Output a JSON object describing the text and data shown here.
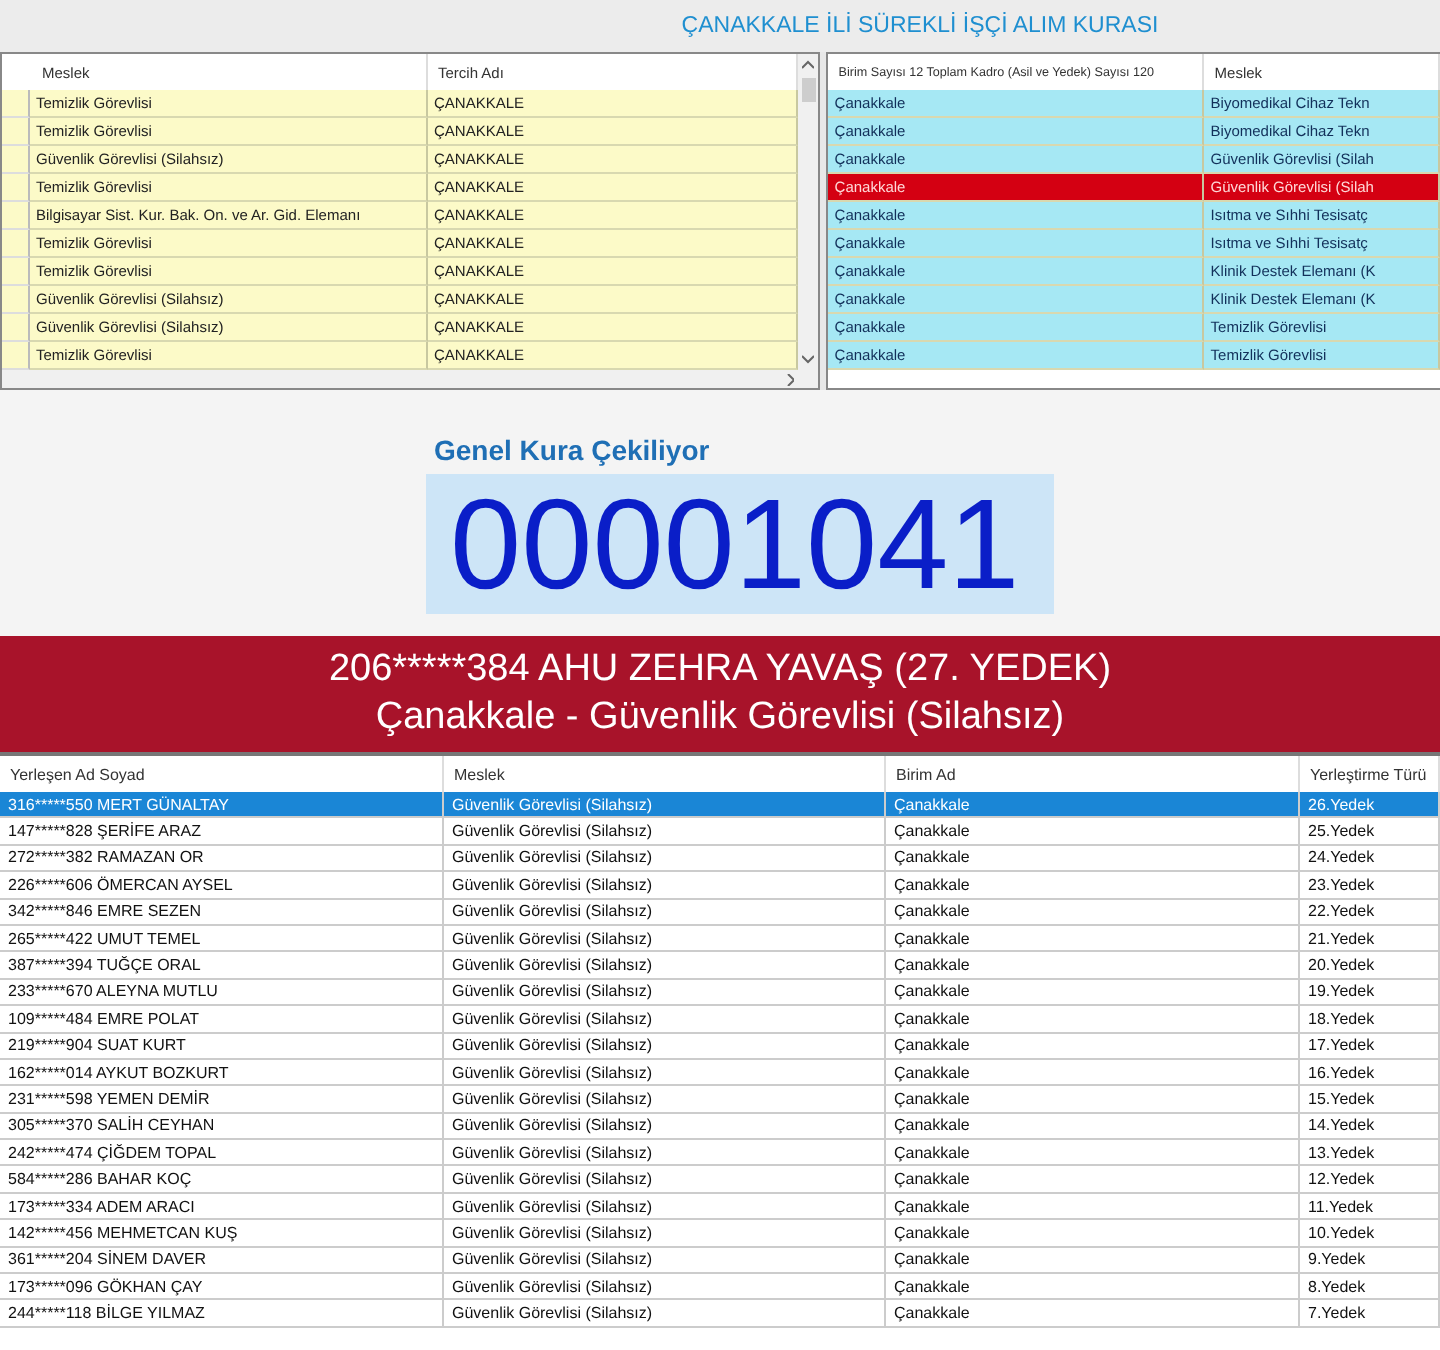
{
  "title": "ÇANAKKALE İLİ SÜREKLİ İŞÇİ ALIM KURASI",
  "preference_table": {
    "columns": [
      "Meslek",
      "Tercih Adı"
    ],
    "rows": [
      {
        "cells": [
          "Temizlik Görevlisi",
          "ÇANAKKALE"
        ]
      },
      {
        "cells": [
          "Temizlik Görevlisi",
          "ÇANAKKALE"
        ]
      },
      {
        "cells": [
          "Güvenlik Görevlisi (Silahsız)",
          "ÇANAKKALE"
        ]
      },
      {
        "cells": [
          "Temizlik Görevlisi",
          "ÇANAKKALE"
        ]
      },
      {
        "cells": [
          "Bilgisayar Sist. Kur. Bak. On. ve Ar. Gid. Elemanı",
          "ÇANAKKALE"
        ]
      },
      {
        "cells": [
          "Temizlik Görevlisi",
          "ÇANAKKALE"
        ]
      },
      {
        "cells": [
          "Temizlik Görevlisi",
          "ÇANAKKALE"
        ]
      },
      {
        "cells": [
          "Güvenlik Görevlisi (Silahsız)",
          "ÇANAKKALE"
        ]
      },
      {
        "cells": [
          "Güvenlik Görevlisi (Silahsız)",
          "ÇANAKKALE"
        ]
      },
      {
        "cells": [
          "Temizlik Görevlisi",
          "ÇANAKKALE"
        ]
      }
    ]
  },
  "unit_table": {
    "columns": [
      "Birim Sayısı 12 Toplam Kadro (Asil ve Yedek) Sayısı 120",
      "Meslek"
    ],
    "rows": [
      {
        "cells": [
          "Çanakkale",
          "Biyomedikal Cihaz Tekn"
        ],
        "selected": false
      },
      {
        "cells": [
          "Çanakkale",
          "Biyomedikal Cihaz Tekn"
        ],
        "selected": false
      },
      {
        "cells": [
          "Çanakkale",
          "Güvenlik Görevlisi (Silah"
        ],
        "selected": false
      },
      {
        "cells": [
          "Çanakkale",
          "Güvenlik Görevlisi (Silah"
        ],
        "selected": true
      },
      {
        "cells": [
          "Çanakkale",
          "Isıtma ve Sıhhi Tesisatç"
        ],
        "selected": false
      },
      {
        "cells": [
          "Çanakkale",
          "Isıtma ve Sıhhi Tesisatç"
        ],
        "selected": false
      },
      {
        "cells": [
          "Çanakkale",
          "Klinik Destek Elemanı (K"
        ],
        "selected": false
      },
      {
        "cells": [
          "Çanakkale",
          "Klinik Destek Elemanı (K"
        ],
        "selected": false
      },
      {
        "cells": [
          "Çanakkale",
          "Temizlik Görevlisi"
        ],
        "selected": false
      },
      {
        "cells": [
          "Çanakkale",
          "Temizlik Görevlisi"
        ],
        "selected": false
      }
    ]
  },
  "draw": {
    "label": "Genel Kura Çekiliyor",
    "number": "00001041",
    "result_line_1": "206*****384 AHU ZEHRA YAVAŞ (27. YEDEK)",
    "result_line_2": "Çanakkale - Güvenlik Görevlisi (Silahsız)"
  },
  "placement_table": {
    "columns": [
      "Yerleşen Ad Soyad",
      "Meslek",
      "Birim Ad",
      "Yerleştirme Türü"
    ],
    "rows": [
      {
        "cells": [
          "316*****550 MERT GÜNALTAY",
          "Güvenlik Görevlisi (Silahsız)",
          "Çanakkale",
          "26.Yedek"
        ],
        "selected": true
      },
      {
        "cells": [
          "147*****828 ŞERİFE ARAZ",
          "Güvenlik Görevlisi (Silahsız)",
          "Çanakkale",
          "25.Yedek"
        ],
        "selected": false
      },
      {
        "cells": [
          "272*****382 RAMAZAN OR",
          "Güvenlik Görevlisi (Silahsız)",
          "Çanakkale",
          "24.Yedek"
        ],
        "selected": false
      },
      {
        "cells": [
          "226*****606 ÖMERCAN AYSEL",
          "Güvenlik Görevlisi (Silahsız)",
          "Çanakkale",
          "23.Yedek"
        ],
        "selected": false
      },
      {
        "cells": [
          "342*****846 EMRE SEZEN",
          "Güvenlik Görevlisi (Silahsız)",
          "Çanakkale",
          "22.Yedek"
        ],
        "selected": false
      },
      {
        "cells": [
          "265*****422 UMUT TEMEL",
          "Güvenlik Görevlisi (Silahsız)",
          "Çanakkale",
          "21.Yedek"
        ],
        "selected": false
      },
      {
        "cells": [
          "387*****394 TUĞÇE ORAL",
          "Güvenlik Görevlisi (Silahsız)",
          "Çanakkale",
          "20.Yedek"
        ],
        "selected": false
      },
      {
        "cells": [
          "233*****670 ALEYNA MUTLU",
          "Güvenlik Görevlisi (Silahsız)",
          "Çanakkale",
          "19.Yedek"
        ],
        "selected": false
      },
      {
        "cells": [
          "109*****484 EMRE POLAT",
          "Güvenlik Görevlisi (Silahsız)",
          "Çanakkale",
          "18.Yedek"
        ],
        "selected": false
      },
      {
        "cells": [
          "219*****904 SUAT KURT",
          "Güvenlik Görevlisi (Silahsız)",
          "Çanakkale",
          "17.Yedek"
        ],
        "selected": false
      },
      {
        "cells": [
          "162*****014 AYKUT BOZKURT",
          "Güvenlik Görevlisi (Silahsız)",
          "Çanakkale",
          "16.Yedek"
        ],
        "selected": false
      },
      {
        "cells": [
          "231*****598 YEMEN DEMİR",
          "Güvenlik Görevlisi (Silahsız)",
          "Çanakkale",
          "15.Yedek"
        ],
        "selected": false
      },
      {
        "cells": [
          "305*****370 SALİH CEYHAN",
          "Güvenlik Görevlisi (Silahsız)",
          "Çanakkale",
          "14.Yedek"
        ],
        "selected": false
      },
      {
        "cells": [
          "242*****474 ÇİĞDEM TOPAL",
          "Güvenlik Görevlisi (Silahsız)",
          "Çanakkale",
          "13.Yedek"
        ],
        "selected": false
      },
      {
        "cells": [
          "584*****286 BAHAR KOÇ",
          "Güvenlik Görevlisi (Silahsız)",
          "Çanakkale",
          "12.Yedek"
        ],
        "selected": false
      },
      {
        "cells": [
          "173*****334 ADEM ARACI",
          "Güvenlik Görevlisi (Silahsız)",
          "Çanakkale",
          "11.Yedek"
        ],
        "selected": false
      },
      {
        "cells": [
          "142*****456 MEHMETCAN KUŞ",
          "Güvenlik Görevlisi (Silahsız)",
          "Çanakkale",
          "10.Yedek"
        ],
        "selected": false
      },
      {
        "cells": [
          "361*****204 SİNEM DAVER",
          "Güvenlik Görevlisi (Silahsız)",
          "Çanakkale",
          "9.Yedek"
        ],
        "selected": false
      },
      {
        "cells": [
          "173*****096 GÖKHAN ÇAY",
          "Güvenlik Görevlisi (Silahsız)",
          "Çanakkale",
          "8.Yedek"
        ],
        "selected": false
      },
      {
        "cells": [
          "244*****118 BİLGE YILMAZ",
          "Güvenlik Görevlisi (Silahsız)",
          "Çanakkale",
          "7.Yedek"
        ],
        "selected": false
      }
    ]
  }
}
